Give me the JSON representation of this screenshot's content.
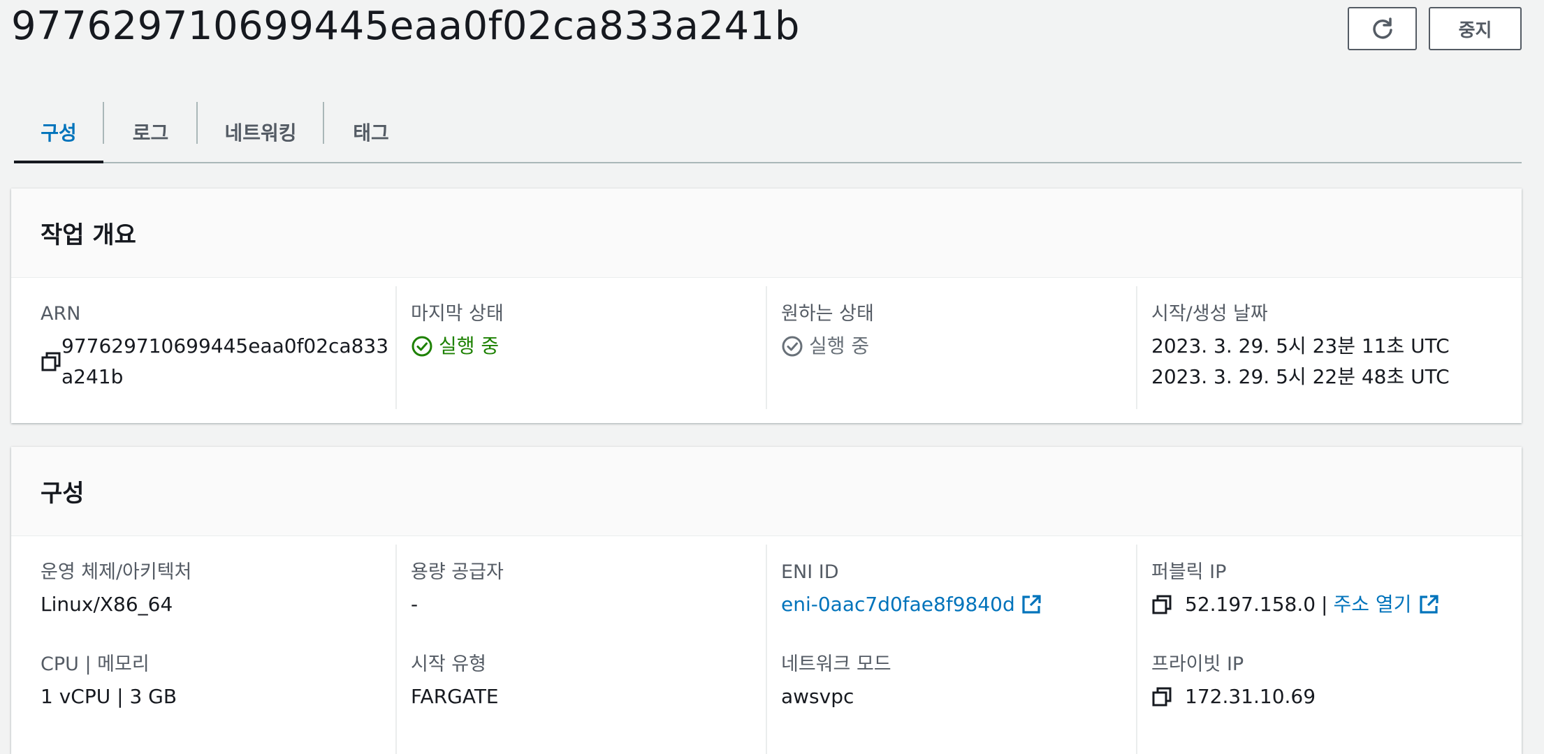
{
  "header": {
    "title": "977629710699445eaa0f02ca833a241b",
    "refresh_icon": "refresh-icon",
    "stop_label": "중지"
  },
  "tabs": [
    {
      "label": "구성",
      "active": true
    },
    {
      "label": "로그",
      "active": false
    },
    {
      "label": "네트워킹",
      "active": false
    },
    {
      "label": "태그",
      "active": false
    }
  ],
  "overview": {
    "title": "작업 개요",
    "arn": {
      "label": "ARN",
      "line1": "977629710699445eaa0f02ca833",
      "line2": "a241b",
      "icon": "copy-icon"
    },
    "last_status": {
      "label": "마지막 상태",
      "value": "실행 중",
      "icon": "check-circle-icon",
      "color": "#1d8102"
    },
    "desired_status": {
      "label": "원하는 상태",
      "value": "실행 중",
      "icon": "check-circle-icon",
      "color": "#687078"
    },
    "dates": {
      "label": "시작/생성 날짜",
      "started": "2023. 3. 29. 5시 23분 11초 UTC",
      "created": "2023. 3. 29. 5시 22분 48초 UTC"
    }
  },
  "config": {
    "title": "구성",
    "os_arch": {
      "label": "운영 체제/아키텍처",
      "value": "Linux/X86_64"
    },
    "capacity_provider": {
      "label": "용량 공급자",
      "value": "-"
    },
    "eni": {
      "label": "ENI ID",
      "value": "eni-0aac7d0fae8f9840d",
      "icon": "external-link-icon"
    },
    "public_ip": {
      "label": "퍼블릭 IP",
      "value": "52.197.158.0",
      "separator": "|",
      "open_label": "주소 열기",
      "icon": "copy-icon",
      "link_icon": "external-link-icon"
    },
    "cpu_mem": {
      "label": "CPU | 메모리",
      "value": "1 vCPU | 3 GB"
    },
    "launch_type": {
      "label": "시작 유형",
      "value": "FARGATE"
    },
    "network_mode": {
      "label": "네트워크 모드",
      "value": "awsvpc"
    },
    "private_ip": {
      "label": "프라이빗 IP",
      "value": "172.31.10.69",
      "icon": "copy-icon"
    }
  },
  "colors": {
    "accent": "#0073bb",
    "success": "#1d8102",
    "muted": "#687078",
    "background": "#f2f3f3"
  }
}
